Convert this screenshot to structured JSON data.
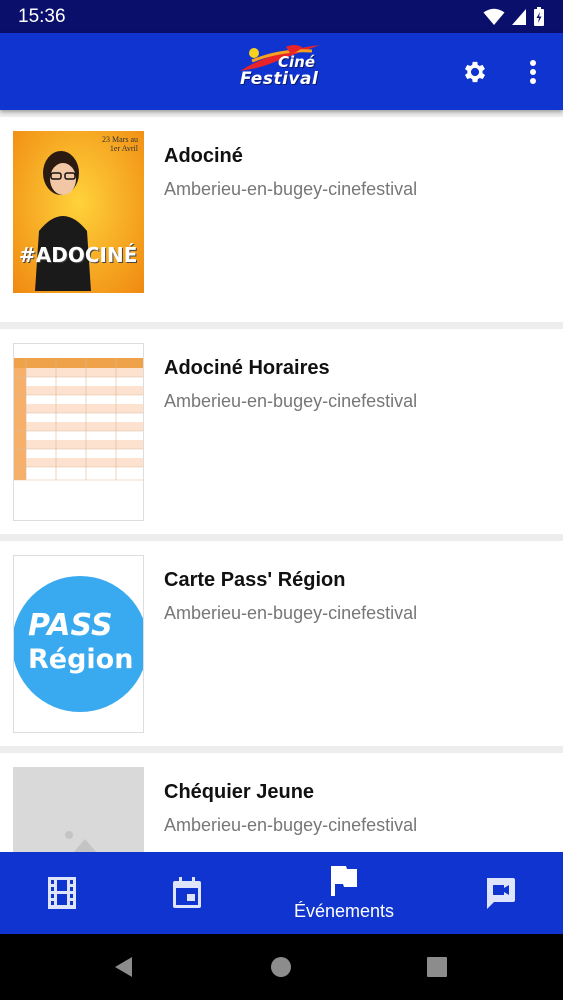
{
  "status_bar": {
    "time": "15:36"
  },
  "app_bar": {
    "logo_text_top": "Ciné",
    "logo_text_bottom": "Festival"
  },
  "events": [
    {
      "title": "Adociné",
      "subtitle": "Amberieu-en-bugey-cinefestival",
      "thumb_text": "#ADOCINÉ",
      "thumb_date": "23 Mars au 1er Avril"
    },
    {
      "title": "Adociné Horaires",
      "subtitle": "Amberieu-en-bugey-cinefestival"
    },
    {
      "title": "Carte Pass' Région",
      "subtitle": "Amberieu-en-bugey-cinefestival",
      "thumb_line1": "PASS",
      "thumb_line2": "Région"
    },
    {
      "title": "Chéquier Jeune",
      "subtitle": "Amberieu-en-bugey-cinefestival"
    }
  ],
  "bottom_nav": {
    "items": [
      {
        "icon": "film-icon"
      },
      {
        "icon": "calendar-icon"
      },
      {
        "icon": "flag-icon",
        "label": "Événements",
        "active": true
      },
      {
        "icon": "video-chat-icon"
      }
    ]
  },
  "colors": {
    "primary": "#1034cf",
    "status_bar": "#0a0f6b",
    "background": "#ededed"
  }
}
